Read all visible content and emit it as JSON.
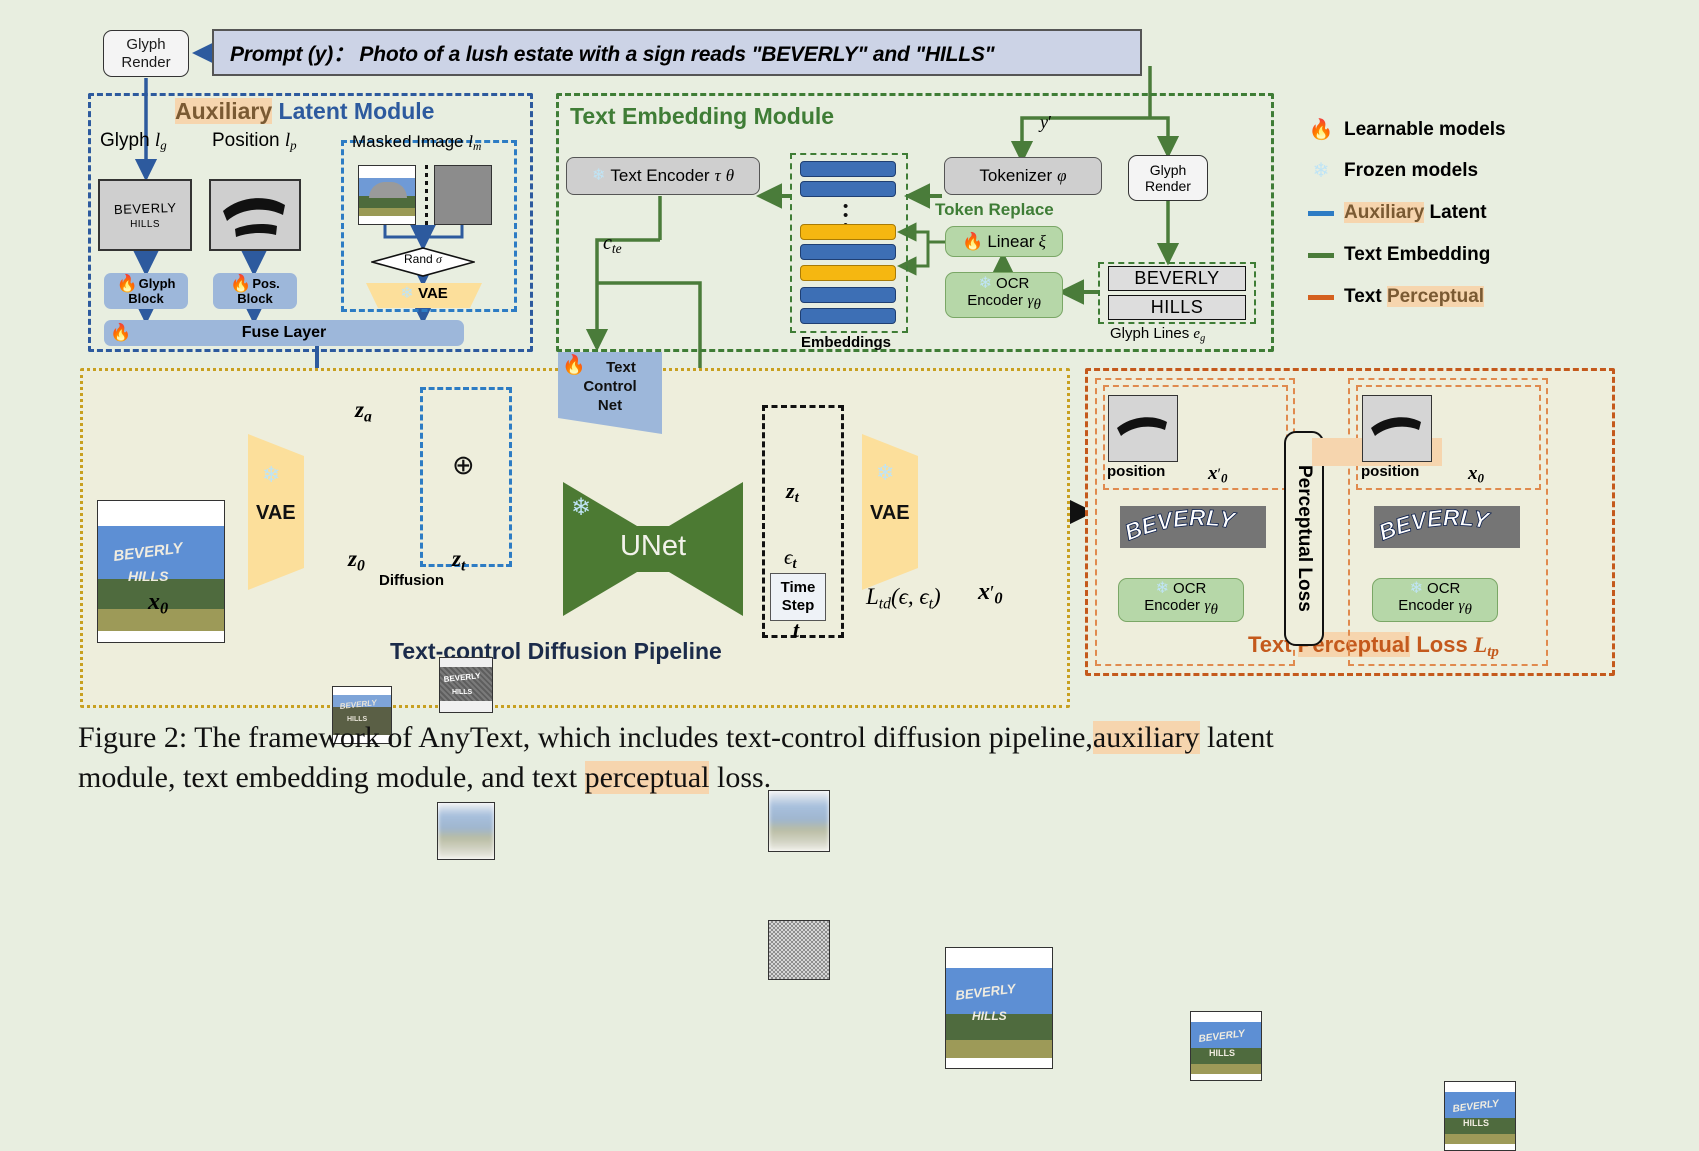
{
  "figure": {
    "caption_1": "Figure 2: The framework of AnyText, which includes text-control diffusion pipeline,",
    "caption_hl": "auxiliary",
    "caption_2": " latent",
    "caption_3": "module, text embedding module, and text ",
    "caption_hl2": "perceptual",
    "caption_4": " loss."
  },
  "prompt": {
    "box_text": "Prompt (y)： Photo of a lush estate with a sign reads \"BEVERLY\" and \"HILLS\"",
    "glyph_render_line1": "Glyph",
    "glyph_render_line2": "Render"
  },
  "aux_module": {
    "title_hl": "Auxiliary",
    "title_rest": " Latent Module",
    "glyph_label": "Glyph",
    "glyph_sym": "l",
    "glyph_sub": "g",
    "position_label": "Position",
    "position_sym": "l",
    "position_sub": "p",
    "masked_label": "Masked Image",
    "masked_sym": "l",
    "masked_sub": "m",
    "glyph_card_line1": "BEVERLY",
    "glyph_card_line2": "HILLS",
    "rand": "Rand",
    "rand_sym": "σ",
    "vae": "VAE",
    "glyph_block_l1": "Glyph",
    "glyph_block_l2": "Block",
    "pos_block_l1": "Pos.",
    "pos_block_l2": "Block",
    "fuse_layer": "Fuse Layer"
  },
  "text_embedding": {
    "title": "Text Embedding Module",
    "text_encoder": "Text Encoder",
    "text_encoder_sym": "τ",
    "text_encoder_sub": "θ",
    "tokenizer": "Tokenizer",
    "tokenizer_sym": "φ",
    "token_replace": "Token Replace",
    "linear": "Linear",
    "linear_sym": "ξ",
    "ocr_encoder_l1": "OCR",
    "ocr_encoder_l2": "Encoder",
    "ocr_sym": "γ",
    "ocr_sub": "θ",
    "embeddings": "Embeddings",
    "y_prime": "y",
    "glyph_render_l1": "Glyph",
    "glyph_render_l2": "Render",
    "glyph_line_1": "BEVERLY",
    "glyph_line_2": "HILLS",
    "glyph_lines_label": "Glyph Lines",
    "glyph_lines_sym": "e",
    "glyph_lines_sub": "g",
    "c_te": "c",
    "c_te_sub": "te"
  },
  "legend": {
    "items": [
      {
        "icon": "flame-icon",
        "label": "Learnable models",
        "color": ""
      },
      {
        "icon": "snowflake-icon",
        "label": "Frozen models",
        "color": ""
      },
      {
        "icon": "line-icon",
        "label_hl": "Auxiliary",
        "label": " Latent",
        "color": "#2d7cc4"
      },
      {
        "icon": "line-icon",
        "label_hl": "",
        "label": "Text Embedding",
        "color": "#4a7c3a"
      },
      {
        "icon": "line-icon",
        "label_hl": "",
        "label": "Text ",
        "label_hl_after": "Perceptual",
        "color": "#d4601f"
      }
    ]
  },
  "pipeline": {
    "title": "Text-control Diffusion Pipeline",
    "vae_left": "VAE",
    "vae_right": "VAE",
    "unet": "UNet",
    "tcn_l1": "Text",
    "tcn_l2": "Control",
    "tcn_l3": "Net",
    "x0": "x",
    "x0_sub": "0",
    "z0": "z",
    "z0_sub": "0",
    "zt": "z",
    "zt_sub": "t",
    "za": "z",
    "za_sub": "a",
    "zt2": "z",
    "zt2_sub": "t",
    "eps_t": "ϵ",
    "eps_t_sub": "t",
    "diffusion": "Diffusion",
    "time_step_l1": "Time",
    "time_step_l2": "Step",
    "time_step_sym": "t",
    "loss_td": "L",
    "loss_td_sub": "td",
    "loss_td_args": "(ϵ, ϵ",
    "loss_td_args_sub": "t",
    "loss_td_close": ")",
    "x0_prime": "x",
    "x0_prime_sub": "0",
    "oplus": "⊕",
    "glyph_sign_l1": "BEVERLY",
    "glyph_sign_l2": "HILLS"
  },
  "perceptual": {
    "title_plain_1": "Text ",
    "title_hl": "Perceptual",
    "title_plain_2": " Loss ",
    "title_sym": "L",
    "title_sub": "tp",
    "perceptual_loss_bar": "Perceptual Loss",
    "left": {
      "position_label": "position",
      "image_label": "x",
      "image_label_prime": "′",
      "image_label_sub": "0",
      "crop_text": "BEVERLY",
      "ocr_l1": "OCR",
      "ocr_l2": "Encoder",
      "ocr_sym": "γ",
      "ocr_sub": "θ"
    },
    "right": {
      "position_label": "position",
      "image_label": "x",
      "image_label_sub": "0",
      "crop_text": "BEVERLY",
      "ocr_l1": "OCR",
      "ocr_l2": "Encoder",
      "ocr_sym": "γ",
      "ocr_sub": "θ"
    }
  },
  "colors": {
    "bg": "#e8eee0",
    "aux_blue": "#2d5a9e",
    "te_green": "#3f7d36",
    "pipe_yellow": "#c8a020",
    "tp_orange": "#c4591c",
    "unet_green": "#4c7a33",
    "vae_yellow": "#fcdf9b",
    "highlight": "#f6d5ae"
  }
}
